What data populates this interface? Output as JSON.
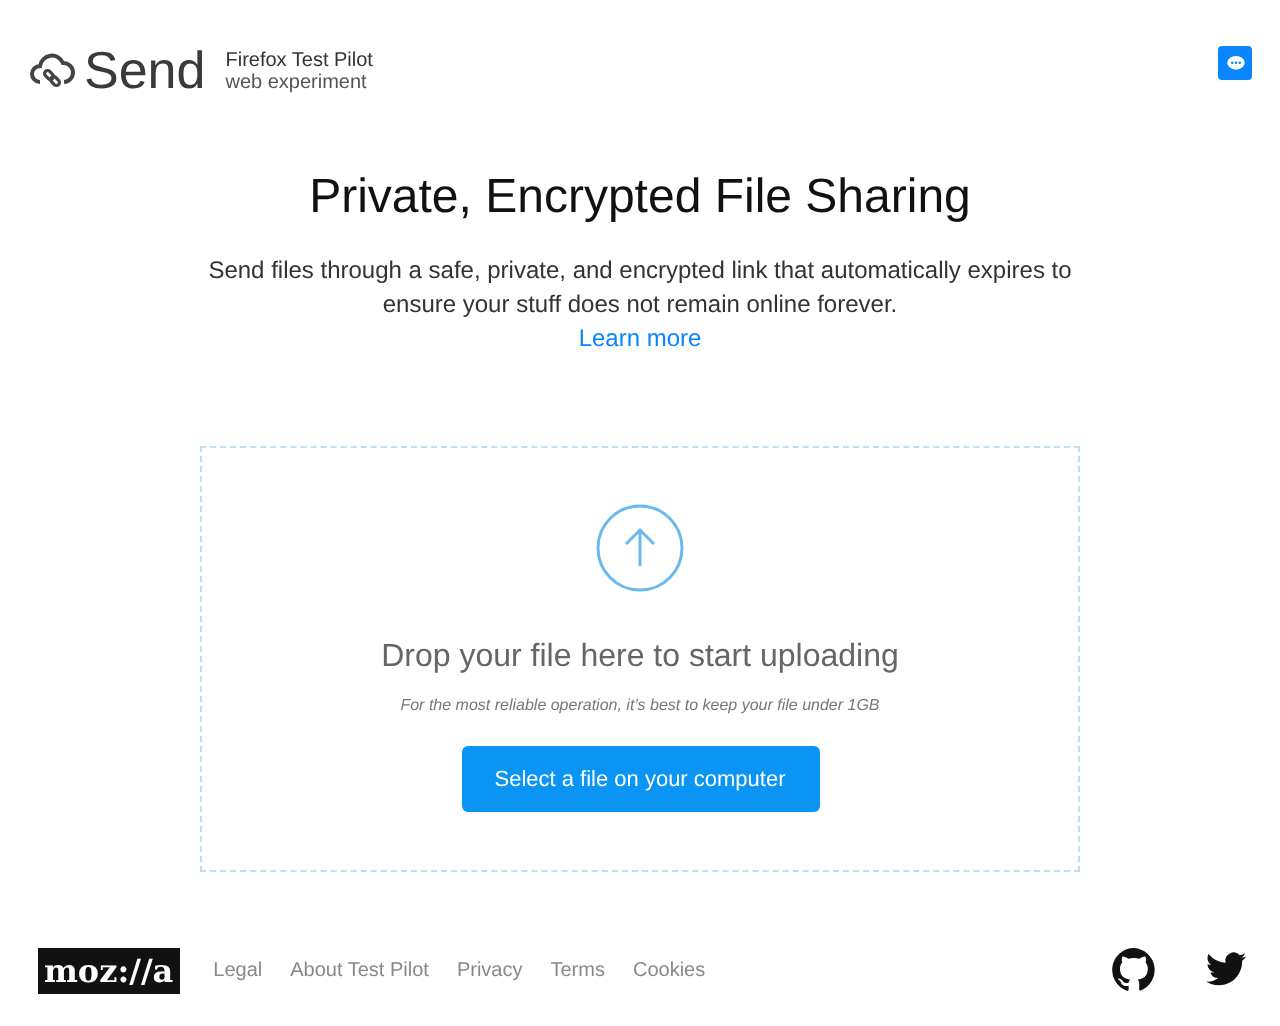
{
  "header": {
    "brand": "Send",
    "subtitle_line1": "Firefox Test Pilot",
    "subtitle_line2": "web experiment"
  },
  "title": "Private, Encrypted File Sharing",
  "description": "Send files through a safe, private, and encrypted link that automatically expires to ensure your stuff does not remain online forever.",
  "learn_more": "Learn more",
  "dropzone": {
    "heading": "Drop your file here to start uploading",
    "note": "For the most reliable operation, it’s best to keep your file under 1GB",
    "button": "Select a file on your computer"
  },
  "footer": {
    "logo": "moz://a",
    "links": [
      "Legal",
      "About Test Pilot",
      "Privacy",
      "Terms",
      "Cookies"
    ]
  }
}
